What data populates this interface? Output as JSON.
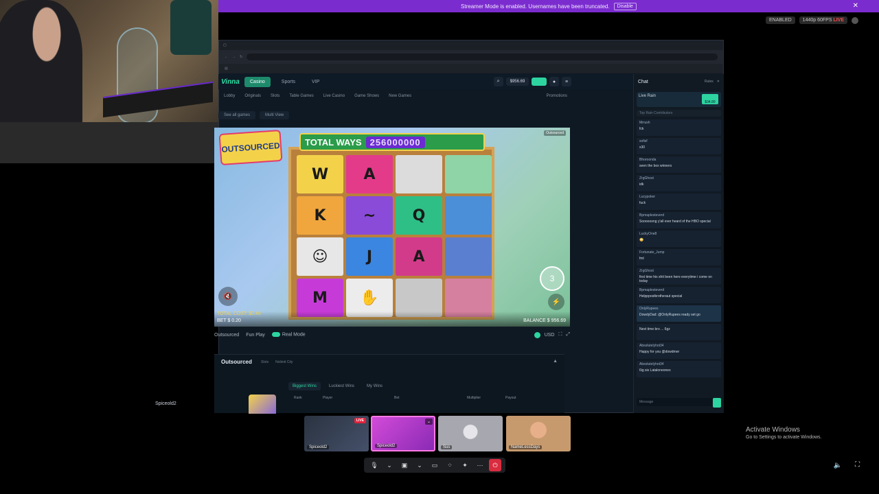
{
  "banner": {
    "text": "Streamer Mode is enabled. Usernames have been truncated.",
    "disable_label": "Disable",
    "close_glyph": "✕"
  },
  "status": {
    "encoding": "ENABLED",
    "quality": "1440p 60FPS",
    "live": "LIVE"
  },
  "site": {
    "header_tabs": [
      "Casino",
      "Sports",
      "VIP"
    ],
    "balance": "$956.69",
    "nav": [
      "Lobby",
      "Originals",
      "Slots",
      "Table Games",
      "Live Casino",
      "Game Shows",
      "New Games"
    ],
    "promotions": "Promotions",
    "see_all": "See all games",
    "multi_view": "Multi View"
  },
  "game": {
    "sticker": "OUTSOURCED",
    "total_ways_label": "TOTAL WAYS",
    "total_ways_value": "256000000",
    "tag": "Outsourced",
    "total_cost": "TOTAL COST: $0.40",
    "bet": "BET $ 0.20",
    "balance": "BALANCE $ 956.69",
    "spin_count": "3",
    "cells": [
      "W",
      "A",
      "",
      "",
      "K",
      "~",
      "Q",
      "",
      "☺",
      "J",
      "A",
      "",
      "M",
      "✋",
      "",
      ""
    ],
    "cell_colors": [
      "#f3d24a",
      "#e33b8a",
      "#dcdcdc",
      "#8fd4a6",
      "#f0a63c",
      "#8a4bd8",
      "#2dbf86",
      "#4b8fd8",
      "#e7e7e7",
      "#3a86e0",
      "#d23b8a",
      "#5a7fd0",
      "#c63bd8",
      "#ececec",
      "#c8c8c8",
      "#d680a0"
    ]
  },
  "gamebar": {
    "name": "Outsourced",
    "fun_play": "Fun Play",
    "real_mode": "Real Mode",
    "currency": "USD"
  },
  "panel": {
    "title": "Outsourced",
    "meta": [
      "Slots",
      "Nolimit City"
    ],
    "tabs": [
      "Biggest Wins",
      "Luckiest Wins",
      "My Wins"
    ],
    "columns": [
      "Rank",
      "Player",
      "Bet",
      "Multiplier",
      "Payout"
    ]
  },
  "chat": {
    "title": "Chat",
    "rules": "Rules",
    "rain_title": "Live Rain",
    "rain_amount": "$34.89",
    "contributors": "Top Rain Contributors",
    "messages": [
      {
        "user": "Mrrush",
        "text": "fck"
      },
      {
        "user": "sofisf",
        "text": "x30"
      },
      {
        "user": "Bhoroonda",
        "text": "seen the box winners"
      },
      {
        "user": "ZrgGhost",
        "text": "idk"
      },
      {
        "user": "Lucypoker",
        "text": "fuck"
      },
      {
        "user": "Bpmaplesteverd",
        "text": "Soooooong y'all ever heard of the HBO special"
      },
      {
        "user": "LuckyOne8",
        "text": "😳"
      },
      {
        "user": "Fortunate_Jump",
        "text": "fml"
      },
      {
        "user": "ZrgGhost",
        "text": "first time his shit been here everytime i come on today"
      },
      {
        "user": "Bpmaplesteverd",
        "text": "Helpppostbrotheraut special"
      },
      {
        "user": "OnlyRupees",
        "text": "DowdyDad: @OnlyRupees ready set go"
      },
      {
        "user": "",
        "text": "Next time bro ... 6gz"
      },
      {
        "user": "Absolutelyhot34",
        "text": "Happy for you @dowdmer"
      },
      {
        "user": "Absolutelyhot34",
        "text": "6ig sis Lataloneones"
      }
    ],
    "input_placeholder": "Message"
  },
  "viewer_label": "Spiceold2",
  "tiles": [
    {
      "name": "Spiceold2",
      "badge": "LIVE"
    },
    {
      "name": "Spiceold2"
    },
    {
      "name": "Sus"
    },
    {
      "name": "NameLessDays"
    }
  ],
  "activate": {
    "title": "Activate Windows",
    "sub": "Go to Settings to activate Windows."
  }
}
